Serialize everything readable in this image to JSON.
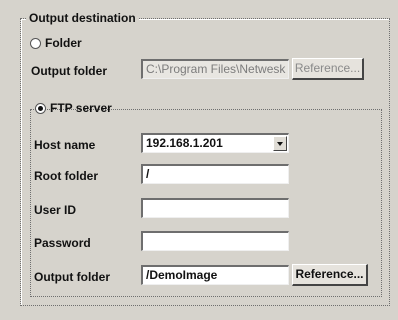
{
  "output_destination": {
    "title": "Output destination",
    "folder_option": {
      "label": "Folder",
      "selected": false,
      "output_folder_label": "Output folder",
      "output_folder_value": "C:\\Program Files\\Netwesk",
      "reference_label": "Reference..."
    },
    "ftp_option": {
      "label": "FTP server",
      "selected": true,
      "host_name_label": "Host name",
      "host_name_value": "192.168.1.201",
      "root_folder_label": "Root folder",
      "root_folder_value": "/",
      "user_id_label": "User ID",
      "user_id_value": "",
      "password_label": "Password",
      "password_value": "",
      "output_folder_label": "Output folder",
      "output_folder_value": "/DemoImage",
      "reference_label": "Reference..."
    }
  }
}
